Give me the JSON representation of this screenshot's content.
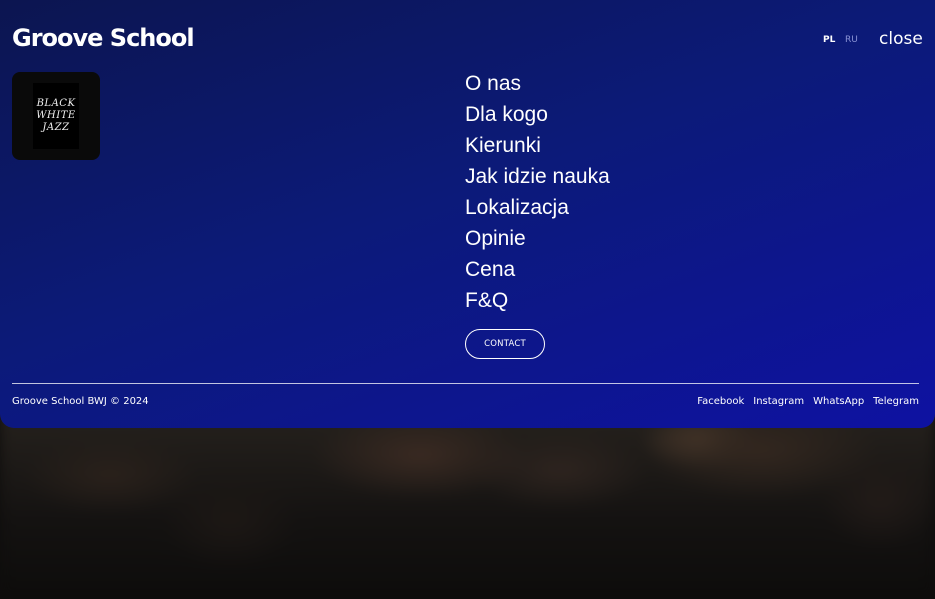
{
  "header": {
    "logo_text": "Groove School",
    "languages": [
      "PL",
      "RU"
    ],
    "active_language": "PL",
    "close_label": "close"
  },
  "badge": {
    "lines": [
      "BLACK",
      "WHITE",
      "JAZZ"
    ]
  },
  "nav": {
    "items": [
      "O nas",
      "Dla kogo",
      "Kierunki",
      "Jak idzie nauka",
      "Lokalizacja",
      "Opinie",
      "Cena",
      "F&Q"
    ]
  },
  "contact": {
    "label": "CONTACT"
  },
  "footer": {
    "copyright": "Groove School BWJ © 2024",
    "socials": [
      "Facebook",
      "Instagram",
      "WhatsApp",
      "Telegram"
    ]
  },
  "colors": {
    "panel_start": "#0c1550",
    "panel_end": "#0e12a2",
    "text": "#ffffff",
    "inactive_lang": "#8a93d6"
  }
}
